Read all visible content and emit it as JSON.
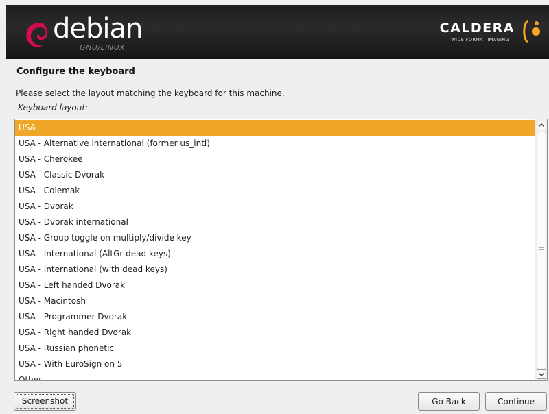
{
  "header": {
    "debian_logo_text": "debian",
    "debian_logo_sub": "GNU/LINUX",
    "caldera_logo_text": "CALDERA",
    "caldera_logo_sub": "WIDE FORMAT IMAGING"
  },
  "page": {
    "title": "Configure the keyboard",
    "description": "Please select the layout matching the keyboard for this machine.",
    "list_label": "Keyboard layout:"
  },
  "layouts": {
    "selected_index": 0,
    "items": [
      "USA",
      "USA - Alternative international (former us_intl)",
      "USA - Cherokee",
      "USA - Classic Dvorak",
      "USA - Colemak",
      "USA - Dvorak",
      "USA - Dvorak international",
      "USA - Group toggle on multiply/divide key",
      "USA - International (AltGr dead keys)",
      "USA - International (with dead keys)",
      "USA - Left handed Dvorak",
      "USA - Macintosh",
      "USA - Programmer Dvorak",
      "USA - Right handed Dvorak",
      "USA - Russian phonetic",
      "USA - With EuroSign on 5",
      "Other"
    ]
  },
  "buttons": {
    "screenshot": "Screenshot",
    "go_back": "Go Back",
    "continue": "Continue"
  },
  "colors": {
    "selection": "#f0a628",
    "banner": "#1f1f1f",
    "debian_red": "#d70a53",
    "caldera_orange": "#f5a623"
  }
}
